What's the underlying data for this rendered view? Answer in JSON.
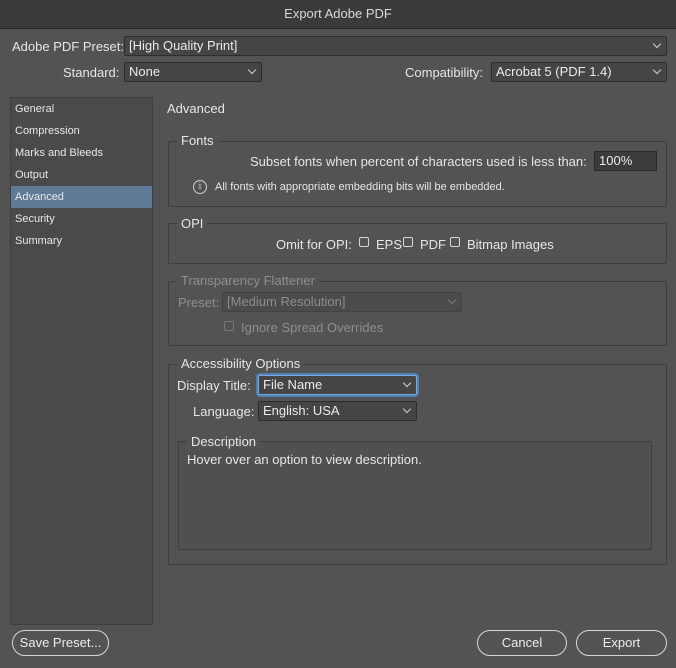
{
  "window": {
    "title": "Export Adobe PDF"
  },
  "preset": {
    "label": "Adobe PDF Preset:",
    "value": "[High Quality Print]"
  },
  "standard": {
    "label": "Standard:",
    "value": "None"
  },
  "compatibility": {
    "label": "Compatibility:",
    "value": "Acrobat 5 (PDF 1.4)"
  },
  "sidebar": {
    "items": [
      {
        "label": "General"
      },
      {
        "label": "Compression"
      },
      {
        "label": "Marks and Bleeds"
      },
      {
        "label": "Output"
      },
      {
        "label": "Advanced",
        "active": true
      },
      {
        "label": "Security"
      },
      {
        "label": "Summary"
      }
    ]
  },
  "main": {
    "heading": "Advanced",
    "fonts": {
      "legend": "Fonts",
      "subset_label": "Subset fonts when percent of characters used is less than:",
      "subset_value": "100%",
      "info_text": "All fonts with appropriate embedding bits will be embedded."
    },
    "opi": {
      "legend": "OPI",
      "omit_label": "Omit for OPI:",
      "eps_label": "EPS",
      "pdf_label": "PDF",
      "bitmap_label": "Bitmap Images"
    },
    "transparency": {
      "legend": "Transparency Flattener",
      "preset_label": "Preset:",
      "preset_value": "[Medium Resolution]",
      "ignore_label": "Ignore Spread Overrides"
    },
    "accessibility": {
      "legend": "Accessibility Options",
      "display_title_label": "Display Title:",
      "display_title_value": "File Name",
      "language_label": "Language:",
      "language_value": "English: USA"
    },
    "description": {
      "legend": "Description",
      "text": "Hover over an option to view description."
    }
  },
  "footer": {
    "save_preset": "Save Preset...",
    "cancel": "Cancel",
    "export": "Export"
  },
  "colors": {
    "selection": "#5e7a96",
    "focus": "#4f7fb5",
    "background": "#535353"
  }
}
